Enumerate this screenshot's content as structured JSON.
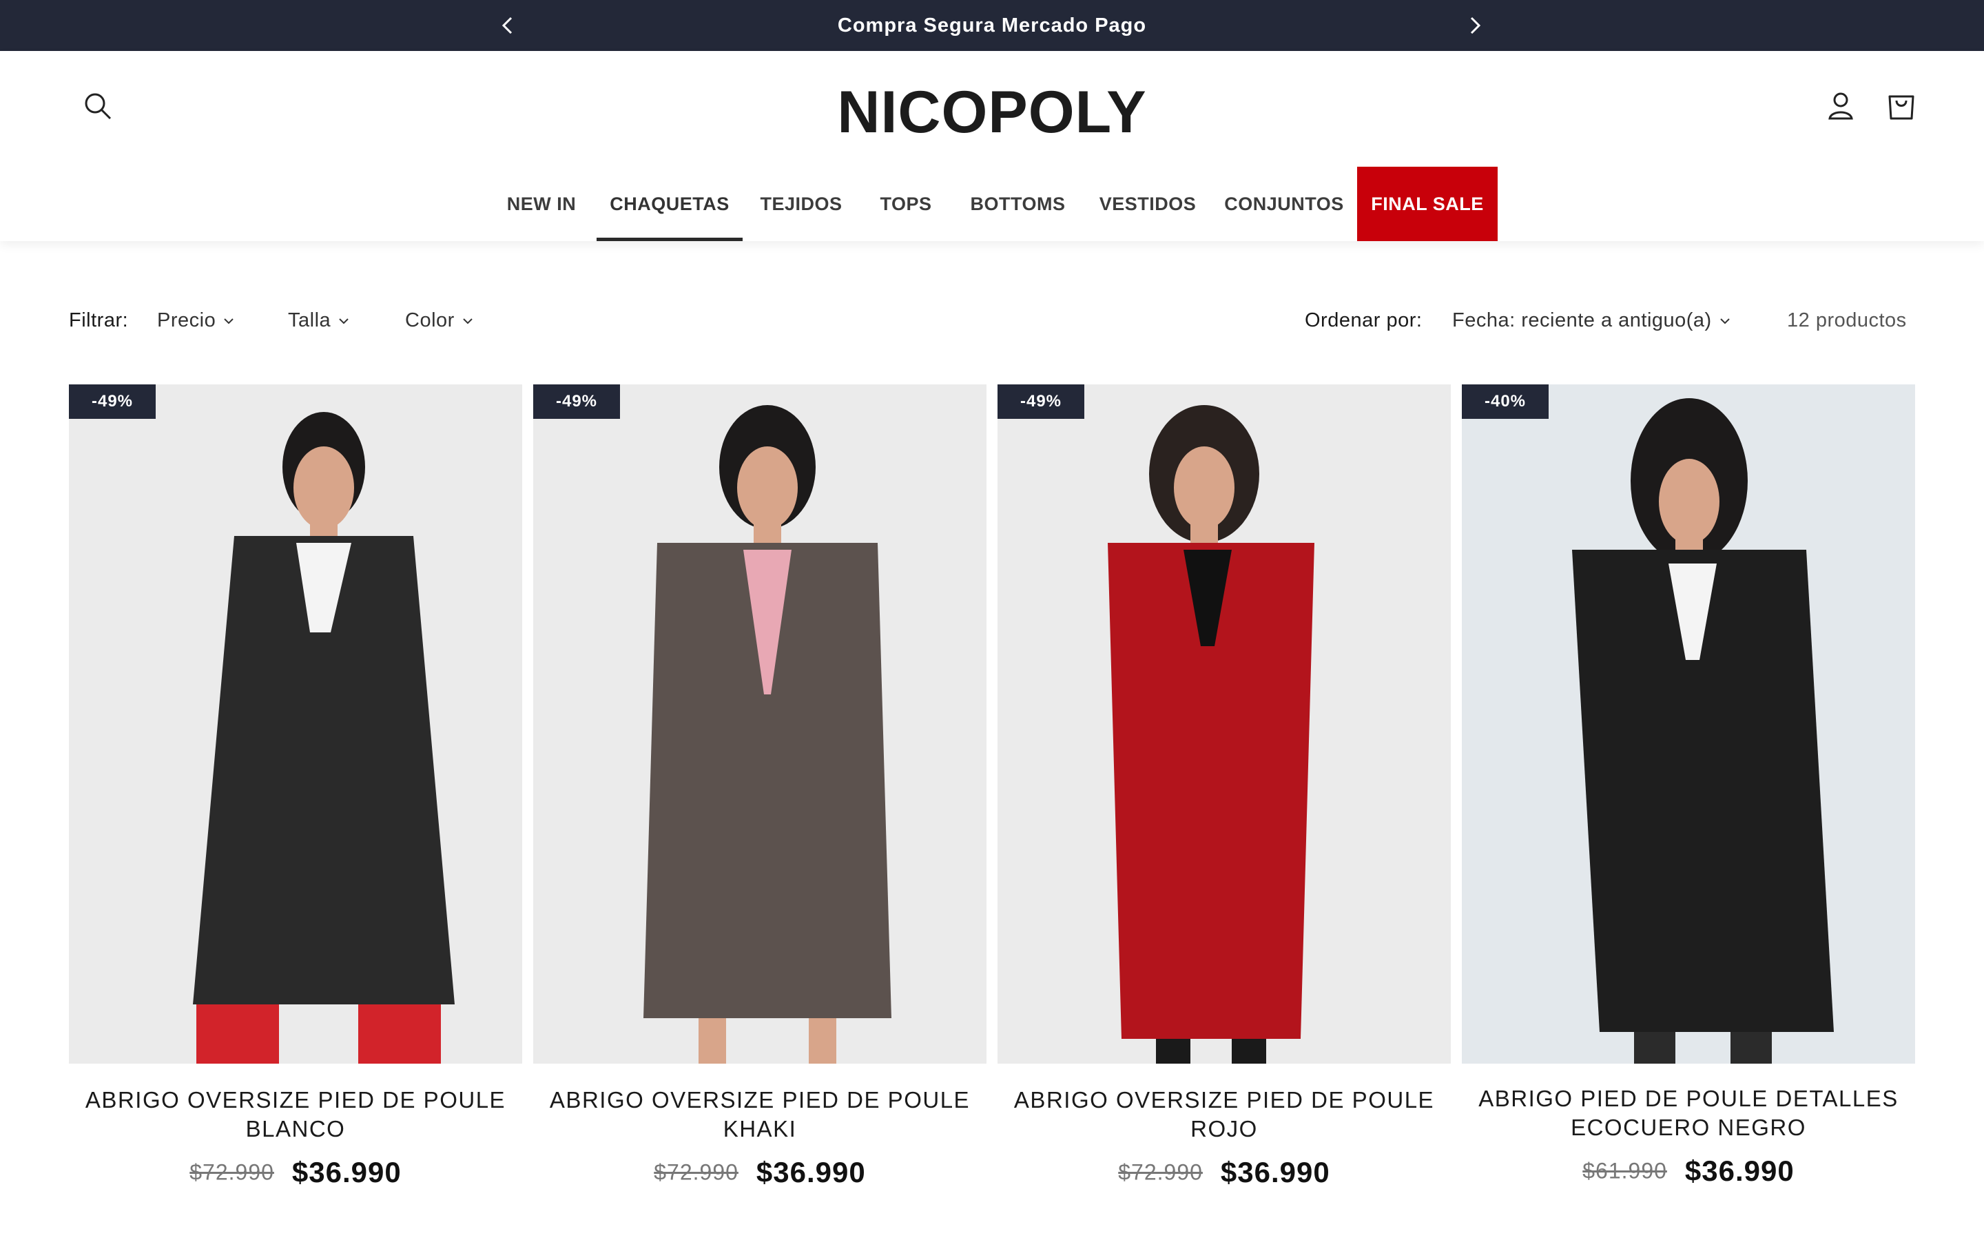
{
  "announcement": {
    "text": "Compra Segura Mercado Pago"
  },
  "header": {
    "logo": "NICOPOLY",
    "nav": [
      "NEW IN",
      "CHAQUETAS",
      "TEJIDOS",
      "TOPS",
      "BOTTOMS",
      "VESTIDOS",
      "CONJUNTOS",
      "FINAL SALE"
    ],
    "active_nav": "CHAQUETAS"
  },
  "filters": {
    "label": "Filtrar:",
    "options": [
      "Precio",
      "Talla",
      "Color"
    ],
    "sort_label": "Ordenar por:",
    "sort_value": "Fecha: reciente a antiguo(a)",
    "count": "12 productos"
  },
  "products": [
    {
      "badge": "-49%",
      "title_line1": "ABRIGO OVERSIZE PIED DE POULE",
      "title_line2": "BLANCO",
      "old_price": "$72.990",
      "new_price": "$36.990",
      "coat_color": "#2a2a2a"
    },
    {
      "badge": "-49%",
      "title_line1": "ABRIGO OVERSIZE PIED DE POULE",
      "title_line2": "KHAKI",
      "old_price": "$72.990",
      "new_price": "$36.990",
      "coat_color": "#5c524e"
    },
    {
      "badge": "-49%",
      "title_line1": "ABRIGO OVERSIZE PIED DE POULE",
      "title_line2": "ROJO",
      "old_price": "$72.990",
      "new_price": "$36.990",
      "coat_color": "#b3141c"
    },
    {
      "badge": "-40%",
      "title_line1": "ABRIGO PIED DE POULE DETALLES",
      "title_line2": "ECOCUERO NEGRO",
      "old_price": "$61.990",
      "new_price": "$36.990",
      "coat_color": "#1e1e1e"
    }
  ],
  "colors": {
    "announcement_bg": "#232838",
    "sale_bg": "#c8000a",
    "badge_bg": "#232838"
  },
  "icons": [
    "chevron-left-icon",
    "chevron-right-icon",
    "search-icon",
    "account-icon",
    "cart-icon",
    "chevron-down-icon"
  ]
}
